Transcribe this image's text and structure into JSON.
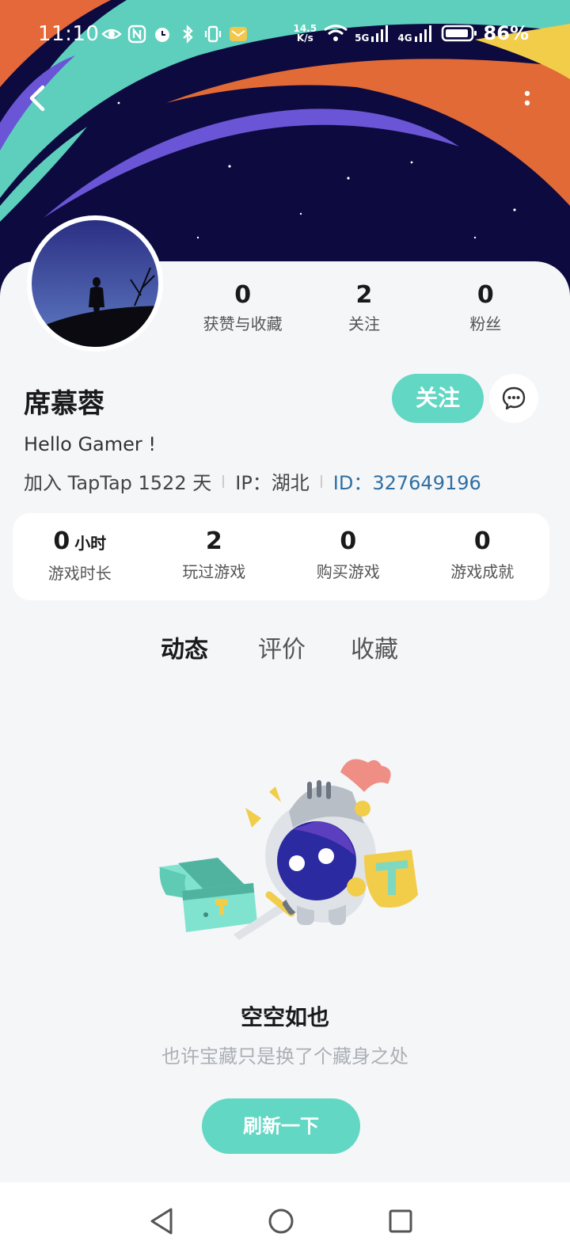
{
  "status_bar": {
    "time": "11:10",
    "net_speed_value": "14.5",
    "net_speed_unit": "K/s",
    "net_5g": "5G",
    "net_4g": "4G",
    "battery": "86%"
  },
  "profile": {
    "name": "席慕蓉",
    "bio": "Hello Gamer !",
    "joined": "加入 TapTap 1522 天",
    "ip": "IP：湖北",
    "id": "ID：327649196",
    "follow_label": "关注"
  },
  "top_stats": [
    {
      "num": "0",
      "label": "获赞与收藏"
    },
    {
      "num": "2",
      "label": "关注"
    },
    {
      "num": "0",
      "label": "粉丝"
    }
  ],
  "game_stats": [
    {
      "num": "0",
      "unit": "小时",
      "label": "游戏时长"
    },
    {
      "num": "2",
      "unit": "",
      "label": "玩过游戏"
    },
    {
      "num": "0",
      "unit": "",
      "label": "购买游戏"
    },
    {
      "num": "0",
      "unit": "",
      "label": "游戏成就"
    }
  ],
  "tabs": [
    {
      "label": "动态",
      "active": true
    },
    {
      "label": "评价",
      "active": false
    },
    {
      "label": "收藏",
      "active": false
    }
  ],
  "empty": {
    "title": "空空如也",
    "subtitle": "也许宝藏只是换了个藏身之处",
    "refresh_label": "刷新一下"
  },
  "colors": {
    "accent": "#62d7c4",
    "id_link": "#2e6fa3",
    "banner_bg": "#0c0a3e"
  },
  "icons": {
    "back": "back-arrow-icon",
    "more": "more-vertical-icon",
    "message": "chat-bubble-icon",
    "nav_back": "triangle-back-icon",
    "nav_home": "circle-home-icon",
    "nav_recent": "square-recent-icon"
  }
}
